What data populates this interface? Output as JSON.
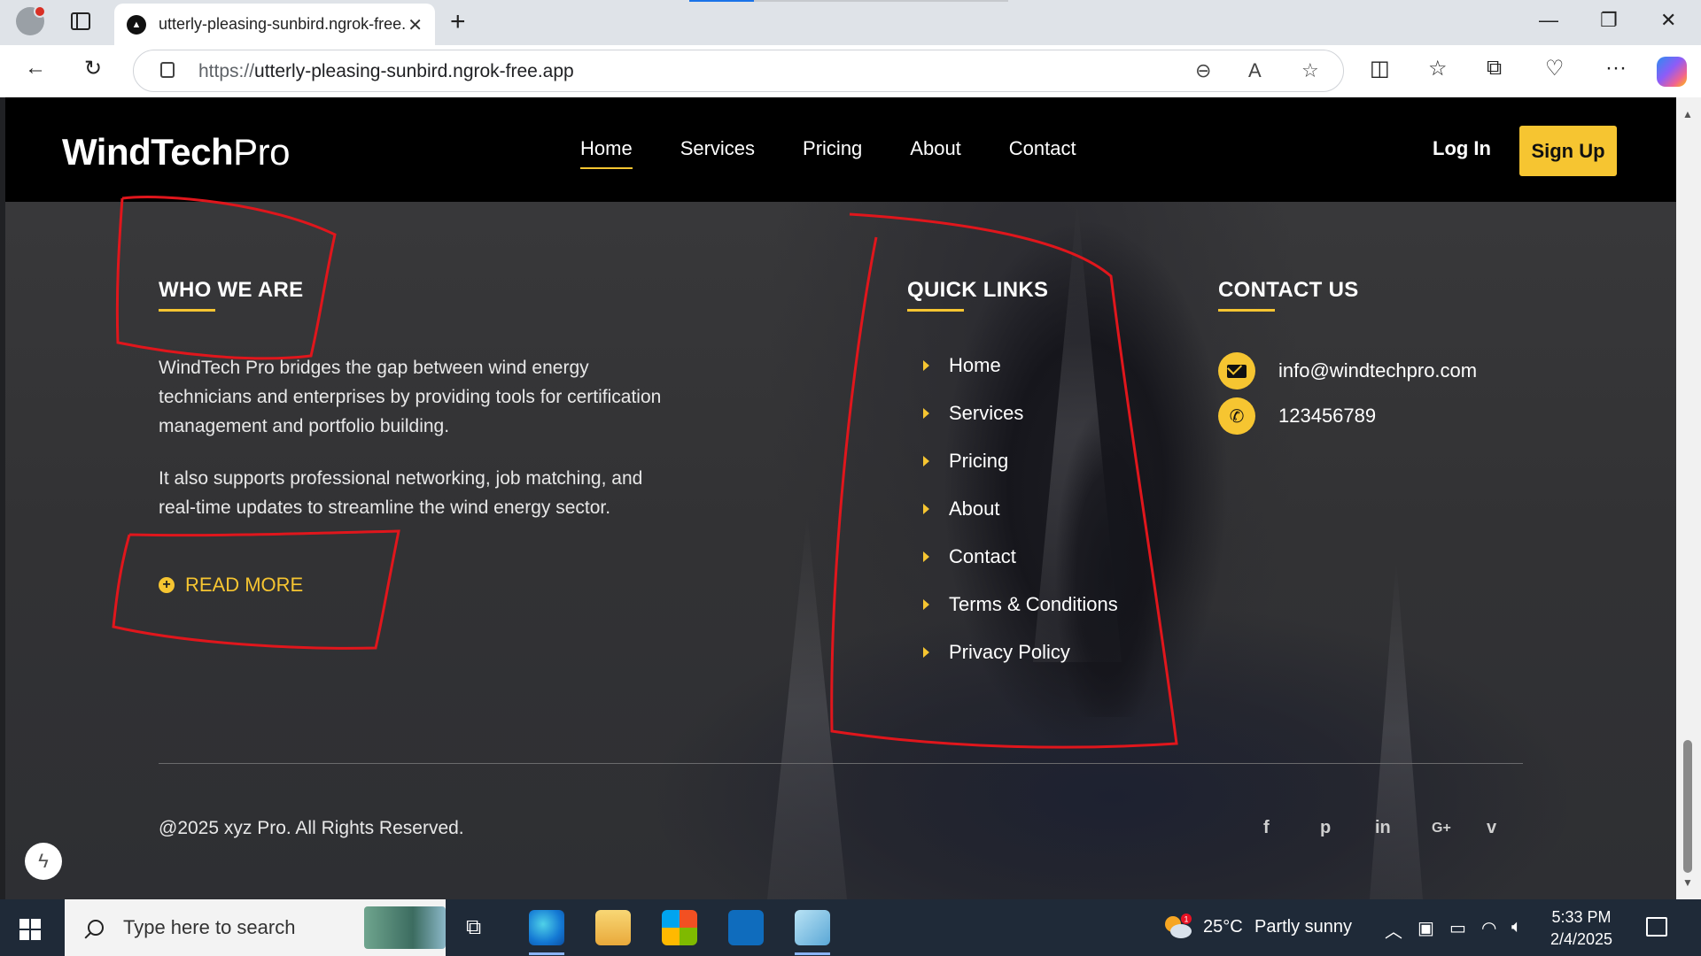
{
  "browser": {
    "tab_title": "utterly-pleasing-sunbird.ngrok-free.app",
    "url_scheme": "https://",
    "url_host": "utterly-pleasing-sunbird.ngrok-free.app"
  },
  "site": {
    "logo_bold": "WindTech",
    "logo_light": "Pro",
    "nav": [
      "Home",
      "Services",
      "Pricing",
      "About",
      "Contact"
    ],
    "active_nav": "Home",
    "login": "Log In",
    "signup": "Sign Up",
    "accent_color": "#f6c531"
  },
  "footer": {
    "who_title": "WHO WE ARE",
    "who_p1": "WindTech Pro bridges the gap between wind energy technicians and enterprises by providing tools for certification management and portfolio building.",
    "who_p2": "It also supports professional networking, job matching, and real-time updates to streamline the wind energy sector.",
    "read_more": "READ MORE",
    "quick_title": "QUICK LINKS",
    "quick_links": [
      "Home",
      "Services",
      "Pricing",
      "About",
      "Contact",
      "Terms & Conditions",
      "Privacy Policy"
    ],
    "contact_title": "CONTACT US",
    "email": "info@windtechpro.com",
    "phone": "123456789",
    "copyright": "@2025 xyz Pro. All Rights Reserved.",
    "social": {
      "facebook": "f",
      "pinterest": "p",
      "linkedin": "in",
      "google_plus": "G+",
      "vimeo": "v"
    }
  },
  "taskbar": {
    "search_placeholder": "Type here to search",
    "weather_temp": "25°C",
    "weather_desc": "Partly sunny",
    "weather_badge": "1",
    "time": "5:33 PM",
    "date": "2/4/2025"
  },
  "icons": {
    "annotation_color": "#e0161c"
  }
}
